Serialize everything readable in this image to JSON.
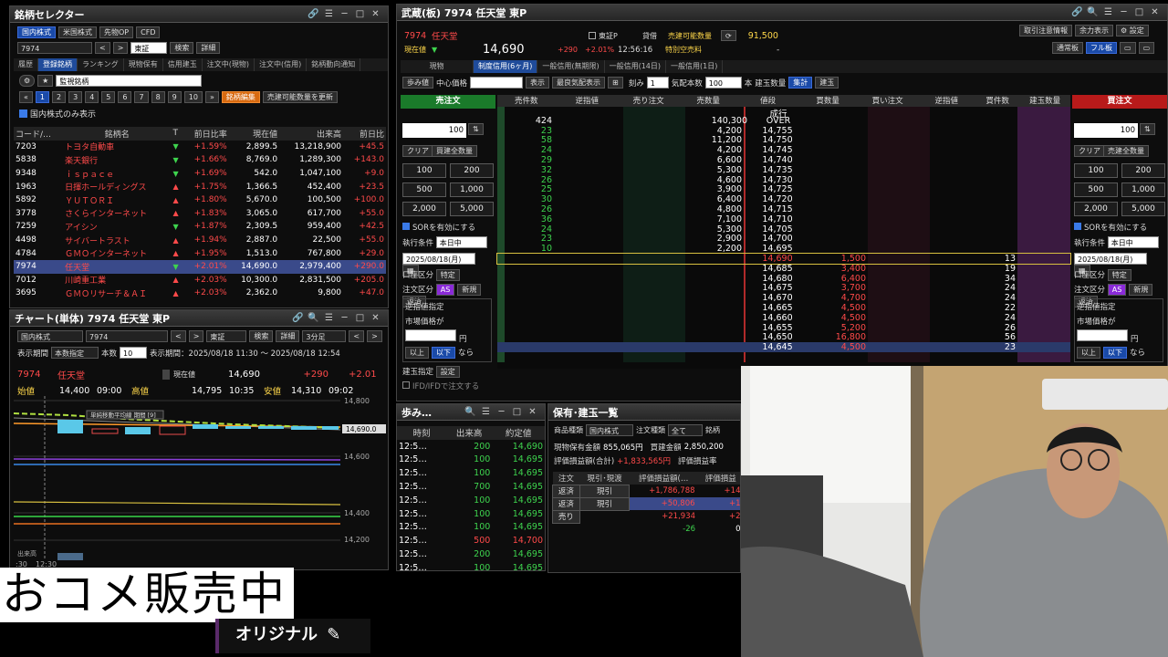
{
  "watchlist": {
    "title": "銘柄セレクター",
    "market_tabs": [
      "国内株式",
      "米国株式",
      "先物OP",
      "CFD"
    ],
    "code": "7974",
    "exchange": "東証",
    "search": "検索",
    "detail": "詳細",
    "subtabs": [
      "履歴",
      "登録銘柄",
      "ランキング",
      "現物保有",
      "信用建玉",
      "注文中(現物)",
      "注文中(信用)",
      "銘柄動向通知"
    ],
    "list_name": "監視銘柄",
    "pages": [
      "1",
      "2",
      "3",
      "4",
      "5",
      "6",
      "7",
      "8",
      "9",
      "10"
    ],
    "edit": "銘柄編集",
    "update": "売建可能数量を更新",
    "only_domestic": "国内株式のみ表示",
    "headers": [
      "コード/…",
      "銘柄名",
      "T",
      "前日比率",
      "現在値",
      "出来高",
      "前日比"
    ],
    "rows": [
      [
        "7203",
        "トヨタ自動車",
        "▼",
        "+1.59%",
        "2,899.5",
        "13,218,900",
        "+45.5"
      ],
      [
        "5838",
        "楽天銀行",
        "▼",
        "+1.66%",
        "8,769.0",
        "1,289,300",
        "+143.0"
      ],
      [
        "9348",
        "ｉｓｐａｃｅ",
        "▼",
        "+1.69%",
        "542.0",
        "1,047,100",
        "+9.0"
      ],
      [
        "1963",
        "日揮ホールディングス",
        "▲",
        "+1.75%",
        "1,366.5",
        "452,400",
        "+23.5"
      ],
      [
        "5892",
        "ＹＵＴＯＲＩ",
        "▲",
        "+1.80%",
        "5,670.0",
        "100,500",
        "+100.0"
      ],
      [
        "3778",
        "さくらインターネット",
        "▲",
        "+1.83%",
        "3,065.0",
        "617,700",
        "+55.0"
      ],
      [
        "7259",
        "アイシン",
        "▼",
        "+1.87%",
        "2,309.5",
        "959,400",
        "+42.5"
      ],
      [
        "4498",
        "サイバートラスト",
        "▲",
        "+1.94%",
        "2,887.0",
        "22,500",
        "+55.0"
      ],
      [
        "4784",
        "ＧＭＯインターネット",
        "▲",
        "+1.95%",
        "1,513.0",
        "767,800",
        "+29.0"
      ],
      [
        "7974",
        "任天堂",
        "▼",
        "+2.01%",
        "14,690.0",
        "2,979,400",
        "+290.0"
      ],
      [
        "7012",
        "川崎重工業",
        "▲",
        "+2.03%",
        "10,300.0",
        "2,831,500",
        "+205.0"
      ],
      [
        "3695",
        "ＧＭＯリサーチ＆ＡＩ",
        "▲",
        "+2.03%",
        "2,362.0",
        "9,800",
        "+47.0"
      ]
    ]
  },
  "chart": {
    "title": "チャート(単体) 7974 任天堂 東P",
    "market": "国内株式",
    "code": "7974",
    "exchange": "東証",
    "search": "検索",
    "detail": "詳細",
    "interval": "3分足",
    "period_label": "表示期間",
    "period_sel": "本数指定",
    "count_label": "本数",
    "count": "10",
    "range_label": "表示期間：",
    "range": "2025/08/18 11:30 〜 2025/08/18 12:54",
    "symbol": "7974",
    "name": "任天堂",
    "price_label": "現在値",
    "price": "14,690",
    "change": "+290",
    "changepct": "+2.01",
    "open_label": "始値",
    "open": "14,400",
    "open_time": "09:00",
    "high_label": "高値",
    "high": "14,795",
    "high_time": "10:35",
    "low_label": "安値",
    "low": "14,310",
    "low_time": "09:02",
    "legend": "単純移動平均線 期間 [9]",
    "yticks": [
      "14,800",
      "14,600",
      "14,400",
      "14,200"
    ],
    "last_tag": "14,690.0",
    "xticks": [
      ":30",
      "12:30"
    ],
    "volume_label": "出来高"
  },
  "board": {
    "title": "武蔵(板) 7974 任天堂 東P",
    "code": "7974",
    "name": "任天堂",
    "status_label": "現在値",
    "price": "14,690",
    "change": "+290",
    "changepct": "+2.01%",
    "time": "12:56:16",
    "market": "東証P",
    "lend_label": "貸借",
    "short_label": "売建可能数量",
    "short_qty": "91,500",
    "special_label": "特別空売料",
    "special_val": "-",
    "right_buttons": [
      "取引注意情報",
      "余力表示",
      "設定"
    ],
    "mode_buttons": [
      "通常板",
      "フル板"
    ],
    "tabs": [
      "現物",
      "制度信用(6ヶ月)",
      "一般信用(無期限)",
      "一般信用(14日)",
      "一般信用(1日)"
    ],
    "toolbar": {
      "ayumi": "歩み値",
      "center": "中心価格",
      "show": "表示",
      "best": "最良気配表示",
      "tick": "刻み",
      "tick_val": "1",
      "special": "気配本数",
      "special_val": "100",
      "unit": "本",
      "close_qty": "建玉数量",
      "total": "集計",
      "close": "建玉"
    },
    "sell_head": "売注文",
    "buy_head": "買注文",
    "ladder_head": [
      "売件数",
      "逆指値",
      "売り注文",
      "売数量",
      "値段",
      "買数量",
      "買い注文",
      "逆指値",
      "買件数",
      "建玉数量"
    ],
    "market_label": "成行",
    "over_label": "OVER",
    "over_cnt": "424",
    "over_qty": "140,300",
    "asks": [
      [
        "23",
        "4,200",
        "14,755"
      ],
      [
        "58",
        "11,200",
        "14,750"
      ],
      [
        "24",
        "4,200",
        "14,745"
      ],
      [
        "29",
        "6,600",
        "14,740"
      ],
      [
        "32",
        "5,300",
        "14,735"
      ],
      [
        "26",
        "4,600",
        "14,730"
      ],
      [
        "25",
        "3,900",
        "14,725"
      ],
      [
        "30",
        "6,400",
        "14,720"
      ],
      [
        "26",
        "4,800",
        "14,715"
      ],
      [
        "36",
        "7,100",
        "14,710"
      ],
      [
        "24",
        "5,300",
        "14,705"
      ],
      [
        "23",
        "2,900",
        "14,700"
      ],
      [
        "10",
        "2,200",
        "14,695"
      ]
    ],
    "bids": [
      [
        "14,690",
        "1,500",
        "13"
      ],
      [
        "14,685",
        "3,400",
        "19"
      ],
      [
        "14,680",
        "6,400",
        "34"
      ],
      [
        "14,675",
        "3,700",
        "24"
      ],
      [
        "14,670",
        "4,700",
        "24"
      ],
      [
        "14,665",
        "4,500",
        "22"
      ],
      [
        "14,660",
        "4,500",
        "24"
      ],
      [
        "14,655",
        "5,200",
        "26"
      ],
      [
        "14,650",
        "16,800",
        "56"
      ],
      [
        "14,645",
        "4,500",
        "23"
      ]
    ],
    "order": {
      "qty": "100",
      "clear": "クリア",
      "all": "買建全数量",
      "sell_all": "売建全数量",
      "q": [
        "100",
        "200",
        "500",
        "1,000",
        "2,000",
        "5,000"
      ],
      "sor": "SORを有効にする",
      "cond_label": "執行条件",
      "cond": "本日中",
      "date": "2025/08/18(月)",
      "acct_label": "口座区分",
      "acct": "特定",
      "type_label": "注文区分",
      "as": "AS",
      "new": "新規",
      "repay": "返済",
      "stop_label": "逆指値指定",
      "mkt_label": "市場価格が",
      "yen": "円",
      "up": "以上",
      "down": "以下",
      "nara": "なら",
      "close_spec": "建玉指定",
      "setting": "設定",
      "ifd": "IFD/IFDで注文する"
    }
  },
  "tape": {
    "title": "歩み…",
    "headers": [
      "時刻",
      "出来高",
      "約定値"
    ],
    "rows": [
      [
        "12:5…",
        "200",
        "14,690"
      ],
      [
        "12:5…",
        "100",
        "14,695"
      ],
      [
        "12:5…",
        "100",
        "14,695"
      ],
      [
        "12:5…",
        "700",
        "14,695"
      ],
      [
        "12:5…",
        "100",
        "14,695"
      ],
      [
        "12:5…",
        "100",
        "14,695"
      ],
      [
        "12:5…",
        "100",
        "14,695"
      ],
      [
        "12:5…",
        "500",
        "14,700"
      ],
      [
        "12:5…",
        "200",
        "14,695"
      ],
      [
        "12:5…",
        "100",
        "14,695"
      ]
    ]
  },
  "positions": {
    "title": "保有･建玉一覧",
    "prod_label": "商品種類",
    "prod": "国内株式",
    "order_label": "注文種類",
    "order": "全て",
    "brand_label": "銘柄",
    "held_label": "現物保有金額",
    "held": "855,065円",
    "buy_label": "買建金額",
    "buy": "2,850,200",
    "pl_label": "評価損益額(合計)",
    "pl": "+1,833,565円",
    "pl2_label": "評価損益率",
    "headers": [
      "注文",
      "現引･現渡",
      "評価損益額(…",
      "評価損益"
    ],
    "rows": [
      [
        "返済",
        "現引",
        "+1,786,788",
        "+14"
      ],
      [
        "返済",
        "現引",
        "+50,806",
        "+1"
      ],
      [
        "売り",
        "",
        "+21,934",
        "+2"
      ],
      [
        "",
        "",
        "-26",
        "0"
      ]
    ]
  },
  "overlay": {
    "caption": "おコメ販売中",
    "button": "オリジナル"
  }
}
